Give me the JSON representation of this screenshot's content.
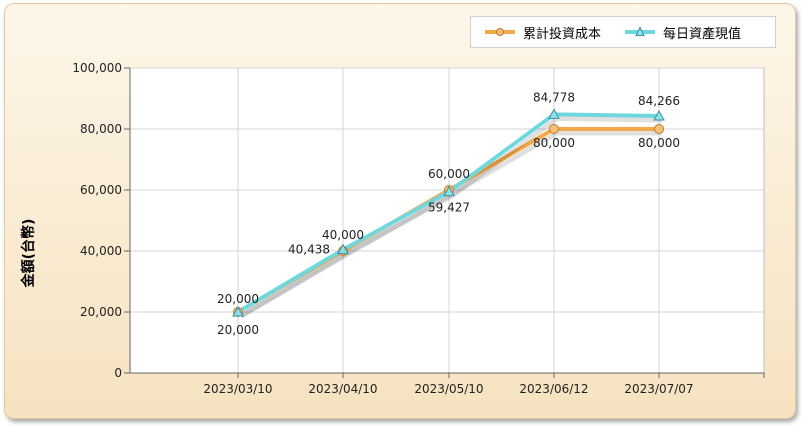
{
  "chart_data": {
    "type": "line",
    "categories": [
      "2023/03/10",
      "2023/04/10",
      "2023/05/10",
      "2023/06/12",
      "2023/07/07"
    ],
    "series": [
      {
        "name": "累計投資成本",
        "values": [
          20000,
          40000,
          60000,
          80000,
          80000
        ],
        "color": "#f5a84a",
        "marker": "circle"
      },
      {
        "name": "每日資產現值",
        "values": [
          20000,
          40438,
          59427,
          84778,
          84266
        ],
        "color": "#6fd8de",
        "marker": "triangle"
      }
    ],
    "data_labels": {
      "cost": [
        "20,000",
        "40,000",
        "60,000",
        "80,000",
        "80,000"
      ],
      "value": [
        "20,000",
        "40,438",
        "59,427",
        "84,778",
        "84,266"
      ]
    },
    "ylabel": "金額(台幣)",
    "ylim": [
      0,
      100000
    ],
    "yticks": [
      "0",
      "20,000",
      "40,000",
      "60,000",
      "80,000",
      "100,000"
    ],
    "grid": true,
    "legend": "top-right"
  }
}
